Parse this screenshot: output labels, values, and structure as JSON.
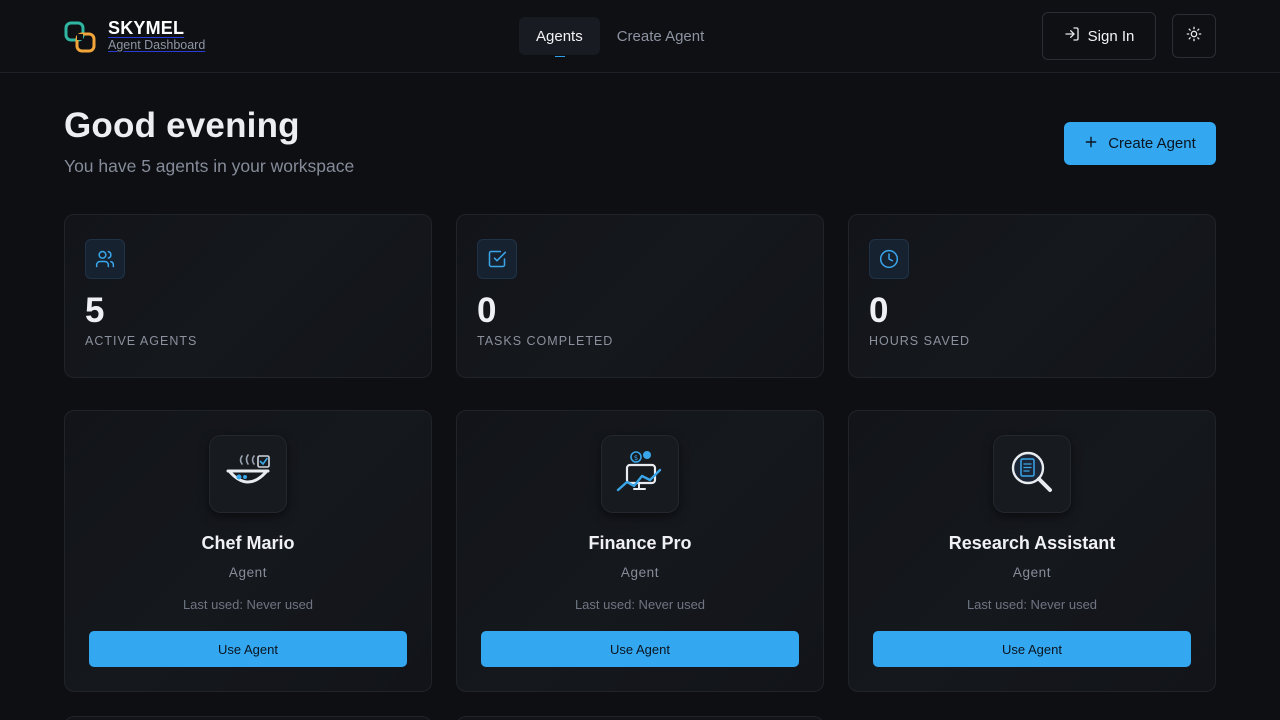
{
  "brand": {
    "name": "SKYMEL",
    "subtitle": "Agent Dashboard",
    "logo_icon": "skymel-logo-icon"
  },
  "nav": {
    "tabs": [
      {
        "label": "Agents",
        "active": true
      },
      {
        "label": "Create Agent",
        "active": false
      }
    ]
  },
  "header": {
    "sign_in_label": "Sign In",
    "sign_in_icon": "sign-in-icon",
    "theme_icon": "sun-icon"
  },
  "greeting": {
    "title": "Good evening",
    "subtitle": "You have 5 agents in your workspace",
    "create_button": "Create Agent"
  },
  "stats": [
    {
      "icon": "users-icon",
      "value": "5",
      "label": "ACTIVE AGENTS"
    },
    {
      "icon": "check-square-icon",
      "value": "0",
      "label": "TASKS COMPLETED"
    },
    {
      "icon": "clock-icon",
      "value": "0",
      "label": "HOURS SAVED"
    }
  ],
  "agents": [
    {
      "name": "Chef Mario",
      "role": "Agent",
      "last_used": "Last used: Never used",
      "button": "Use Agent",
      "icon": "chef-cooking-pot-icon"
    },
    {
      "name": "Finance Pro",
      "role": "Agent",
      "last_used": "Last used: Never used",
      "button": "Use Agent",
      "icon": "finance-chart-icon"
    },
    {
      "name": "Research Assistant",
      "role": "Agent",
      "last_used": "Last used: Never used",
      "button": "Use Agent",
      "icon": "magnifier-document-icon"
    }
  ],
  "colors": {
    "accent": "#33a8f0",
    "background": "#0d0f13",
    "card": "#121419"
  }
}
